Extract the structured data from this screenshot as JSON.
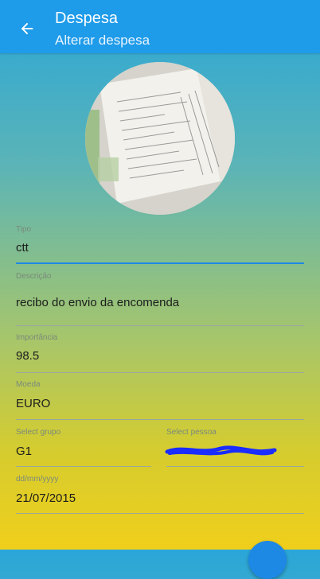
{
  "appbar": {
    "back_icon": "arrow-left-icon",
    "title": "Despesa",
    "subtitle": "Alterar despesa"
  },
  "photo": {
    "icon": "receipt-photo"
  },
  "form": {
    "tipo": {
      "label": "Tipo",
      "value": "ctt"
    },
    "descricao": {
      "label": "Descrição",
      "value": "recibo do envio da encomenda"
    },
    "importancia": {
      "label": "Importância",
      "value": "98.5"
    },
    "moeda": {
      "label": "Moeda",
      "value": "EURO"
    },
    "grupo": {
      "label": "Select grupo",
      "value": "G1"
    },
    "pessoa": {
      "label": "Select pessoa",
      "value": ""
    },
    "data": {
      "label": "dd/mm/yyyy",
      "value": "21/07/2015"
    }
  },
  "colors": {
    "accent": "#1e88e5",
    "appbar": "#1e9be9"
  }
}
